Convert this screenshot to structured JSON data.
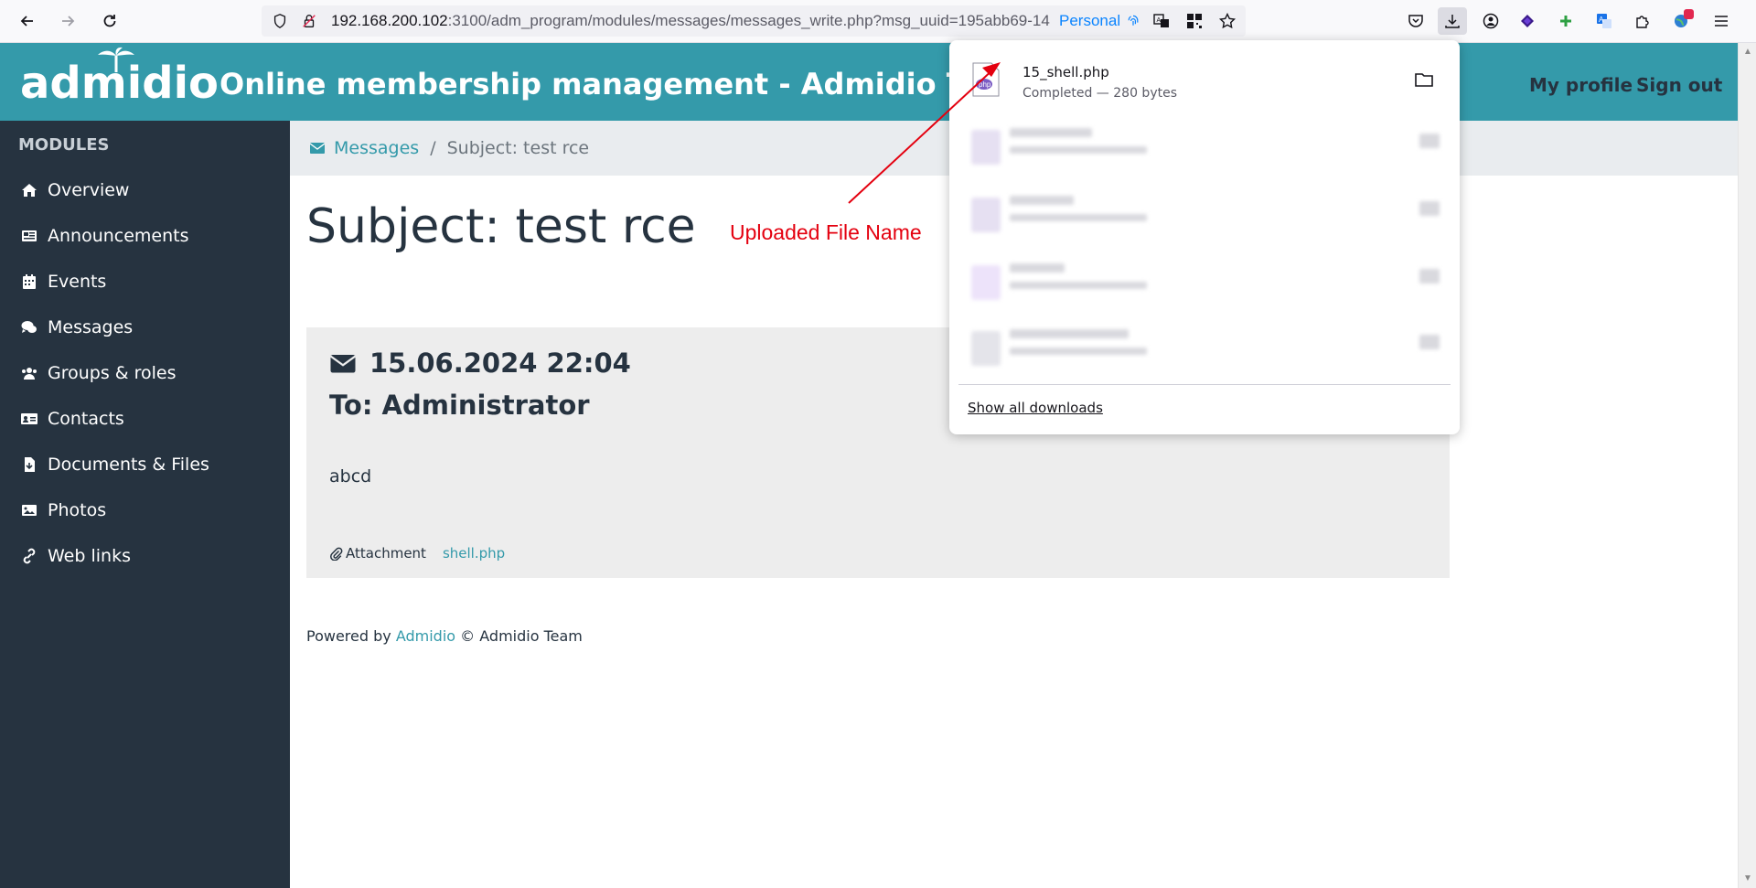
{
  "browser": {
    "url_host": "192.168.200.102",
    "url_rest": ":3100/adm_program/modules/messages/messages_write.php?msg_uuid=195abb69-14",
    "container": "Personal"
  },
  "header": {
    "logo": "admidio",
    "title": "Online membership management - Admidio Test",
    "my_profile": "My profile",
    "sign_out": "Sign out"
  },
  "sidebar": {
    "heading": "MODULES",
    "items": [
      {
        "label": "Overview",
        "icon": "home-icon"
      },
      {
        "label": "Announcements",
        "icon": "newspaper-icon"
      },
      {
        "label": "Events",
        "icon": "calendar-icon"
      },
      {
        "label": "Messages",
        "icon": "comments-icon"
      },
      {
        "label": "Groups & roles",
        "icon": "users-icon"
      },
      {
        "label": "Contacts",
        "icon": "address-card-icon"
      },
      {
        "label": "Documents & Files",
        "icon": "file-download-icon"
      },
      {
        "label": "Photos",
        "icon": "image-icon"
      },
      {
        "label": "Web links",
        "icon": "link-icon"
      }
    ]
  },
  "breadcrumb": {
    "parent": "Messages",
    "separator": "/",
    "current": "Subject: test rce"
  },
  "page": {
    "title": "Subject: test rce",
    "annotation": "Uploaded File Name"
  },
  "message": {
    "date": "15.06.2024 22:04",
    "to": "To: Administrator",
    "body": "abcd",
    "attachment_label": "Attachment",
    "attachment_file": "shell.php"
  },
  "footer": {
    "powered_by": "Powered by",
    "link": "Admidio",
    "team": "© Admidio Team"
  },
  "downloads": {
    "first_name": "15_shell.php",
    "first_status": "Completed — 280 bytes",
    "show_all": "Show all downloads"
  },
  "colors": {
    "brand": "#349aaa",
    "sidebar": "#263340",
    "annotation": "#e4000f"
  }
}
